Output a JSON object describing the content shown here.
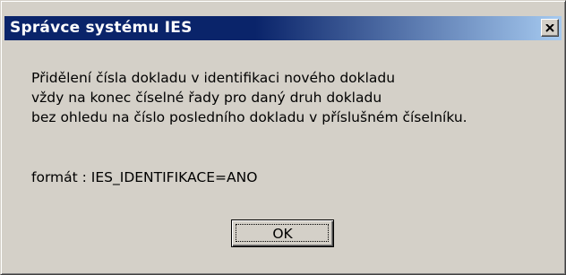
{
  "window": {
    "title": "Správce systému IES",
    "close_icon": "close-icon"
  },
  "message": {
    "lines": [
      "Přidělení čísla dokladu v identifikaci nového dokladu",
      "vždy na konec číselné řady pro daný druh dokladu",
      "bez ohledu na číslo posledního dokladu v příslušném číselníku."
    ],
    "format": "formát : IES_IDENTIFIKACE=ANO"
  },
  "buttons": {
    "ok_label": "OK"
  },
  "colors": {
    "title_active": "#0a246a",
    "title_gradient_end": "#a6caf0",
    "face": "#d4d0c8"
  }
}
